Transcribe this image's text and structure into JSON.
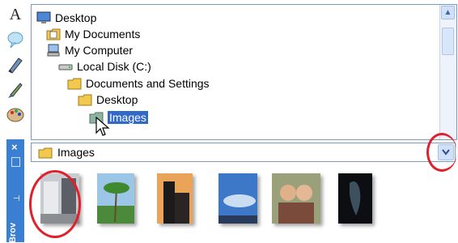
{
  "toolbar": {
    "text_tool_glyph": "A",
    "icons": [
      "text-tool-icon",
      "speech-bubble-icon",
      "pen-icon",
      "brush-icon",
      "palette-icon"
    ]
  },
  "side_strip": {
    "close_glyph": "×",
    "pin_glyph": "⊣",
    "label": "Brov"
  },
  "folder_tree": {
    "items": [
      {
        "label": "Desktop",
        "icon": "desktop-icon"
      },
      {
        "label": "My Documents",
        "icon": "my-documents-icon"
      },
      {
        "label": "My Computer",
        "icon": "my-computer-icon"
      },
      {
        "label": "Local Disk (C:)",
        "icon": "disk-drive-icon"
      },
      {
        "label": "Documents and Settings",
        "icon": "folder-icon"
      },
      {
        "label": "Desktop",
        "icon": "folder-icon"
      },
      {
        "label": "Images",
        "icon": "folder-icon",
        "selected": true
      }
    ],
    "scroll_up": "▲",
    "scroll_down": "▼"
  },
  "location_dropdown": {
    "value": "Images",
    "arrow": "⌄"
  },
  "thumbnails": [
    {
      "name": "street-scene-photo"
    },
    {
      "name": "palm-tree-photo"
    },
    {
      "name": "silhouette-building-photo"
    },
    {
      "name": "sky-photo"
    },
    {
      "name": "couple-portrait-photo"
    },
    {
      "name": "dark-sculpture-photo"
    }
  ],
  "colors": {
    "selection": "#3169c6",
    "annotation": "#e0202a",
    "panel_border": "#7a9ac6"
  }
}
